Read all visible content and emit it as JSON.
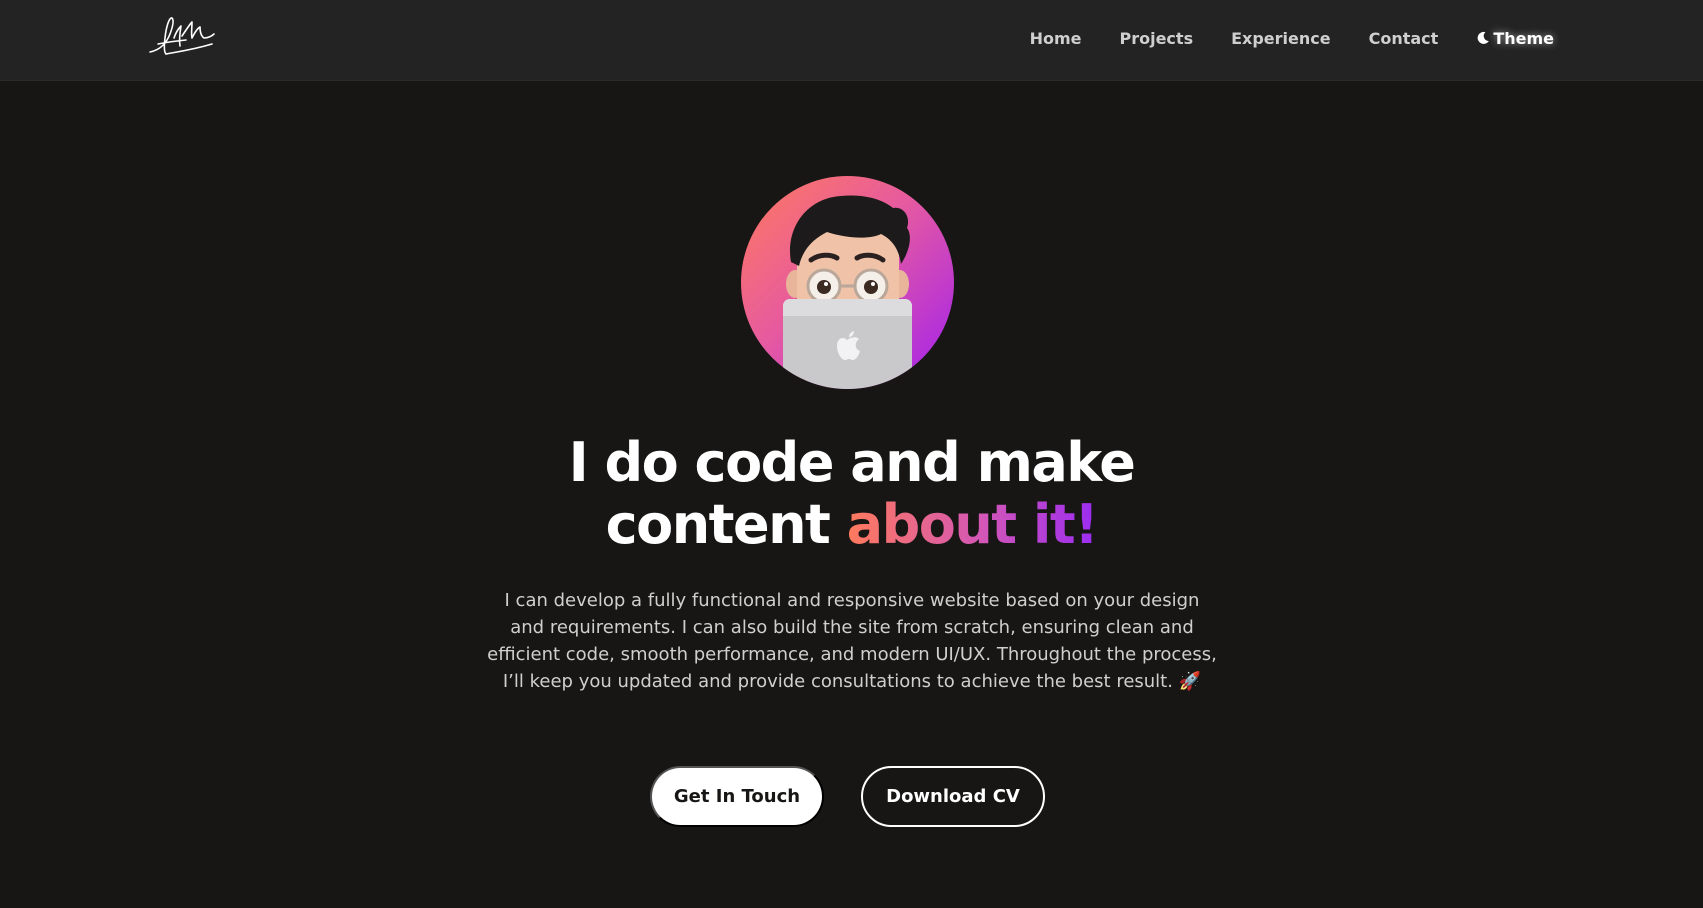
{
  "nav": {
    "logo_alt": "AM",
    "links": [
      "Home",
      "Projects",
      "Experience",
      "Contact"
    ],
    "theme_label": "Theme",
    "theme_icon": "moon-icon"
  },
  "hero": {
    "avatar_icon": "memoji-avatar",
    "headline_line1": "I do code and make",
    "headline_line2_plain": "content",
    "headline_line2_accent": "about it!",
    "intro": "I can develop a fully functional and responsive website based on your design and requirements. I can also build the site from scratch, ensuring clean and efficient code, smooth performance, and modern UI/UX. Throughout the process, I’ll keep you updated and provide consultations to achieve the best result. 🚀",
    "primary_button": "Get In Touch",
    "secondary_button": "Download CV"
  },
  "colors": {
    "background": "#171615",
    "navbar": "#232323",
    "accent_start": "#ff7a5c",
    "accent_end": "#9b2cf2"
  }
}
